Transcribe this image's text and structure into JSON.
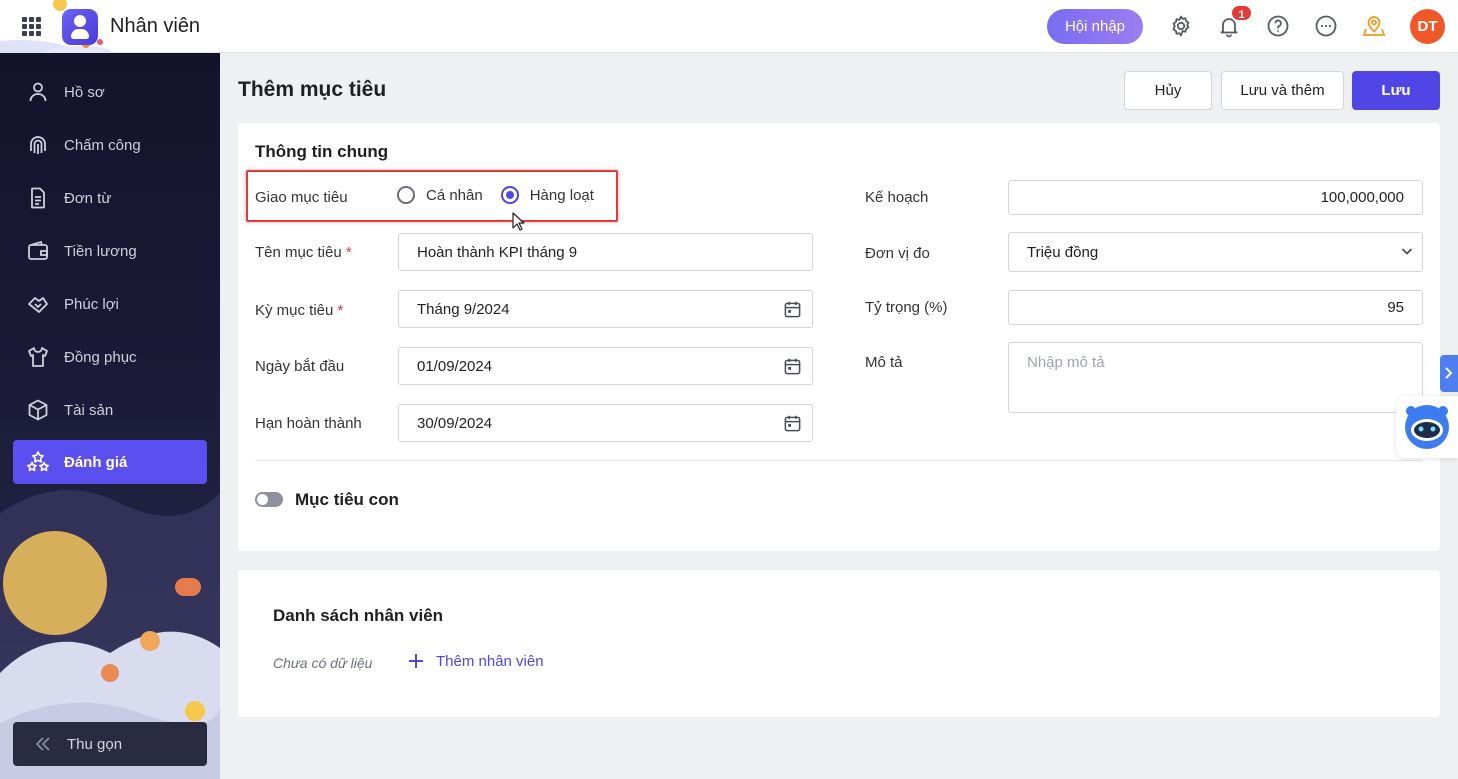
{
  "app": {
    "title": "Nhân viên"
  },
  "header": {
    "hoi_nhap_label": "Hội nhập",
    "notification_count": "1",
    "avatar_initials": "DT",
    "icons": [
      "apps-grid-icon",
      "gear-icon",
      "bell-icon",
      "help-icon",
      "more-icon",
      "location-icon"
    ]
  },
  "sidebar": {
    "items": [
      {
        "label": "Hồ sơ",
        "icon": "user-icon",
        "active": false
      },
      {
        "label": "Chấm công",
        "icon": "fingerprint-icon",
        "active": false
      },
      {
        "label": "Đơn từ",
        "icon": "document-icon",
        "active": false
      },
      {
        "label": "Tiền lương",
        "icon": "wallet-icon",
        "active": false
      },
      {
        "label": "Phúc lợi",
        "icon": "handshake-icon",
        "active": false
      },
      {
        "label": "Đồng phục",
        "icon": "shirt-icon",
        "active": false
      },
      {
        "label": "Tài sản",
        "icon": "box-icon",
        "active": false
      },
      {
        "label": "Đánh giá",
        "icon": "stars-icon",
        "active": true
      }
    ],
    "collapse_label": "Thu gọn"
  },
  "page": {
    "title": "Thêm mục tiêu",
    "cancel_label": "Hủy",
    "save_add_label": "Lưu và thêm",
    "save_label": "Lưu"
  },
  "general": {
    "section_title": "Thông tin chung",
    "assign_label": "Giao mục tiêu",
    "assign_options": [
      {
        "label": "Cá nhân",
        "checked": false
      },
      {
        "label": "Hàng loạt",
        "checked": true
      }
    ],
    "name_label": "Tên mục tiêu",
    "name_value": "Hoàn thành KPI tháng 9",
    "period_label": "Kỳ mục tiêu",
    "period_value": "Tháng 9/2024",
    "start_label": "Ngày bắt đầu",
    "start_value": "01/09/2024",
    "deadline_label": "Hạn hoàn thành",
    "deadline_value": "30/09/2024",
    "plan_label": "Kế hoạch",
    "plan_value": "100,000,000",
    "unit_label": "Đơn vị đo",
    "unit_value": "Triệu đồng",
    "weight_label": "Tỷ trọng (%)",
    "weight_value": "95",
    "desc_label": "Mô tả",
    "desc_placeholder": "Nhập mô tả",
    "required_mark": "*",
    "subgoal_label": "Mục tiêu con",
    "subgoal_enabled": false
  },
  "employees": {
    "section_title": "Danh sách nhân viên",
    "empty_text": "Chưa có dữ liệu",
    "add_label": "Thêm nhân viên"
  },
  "colors": {
    "primary": "#4f46e5",
    "sidebar_bg": "#13132b",
    "highlight": "#e23b3b",
    "avatar": "#f0582a"
  }
}
